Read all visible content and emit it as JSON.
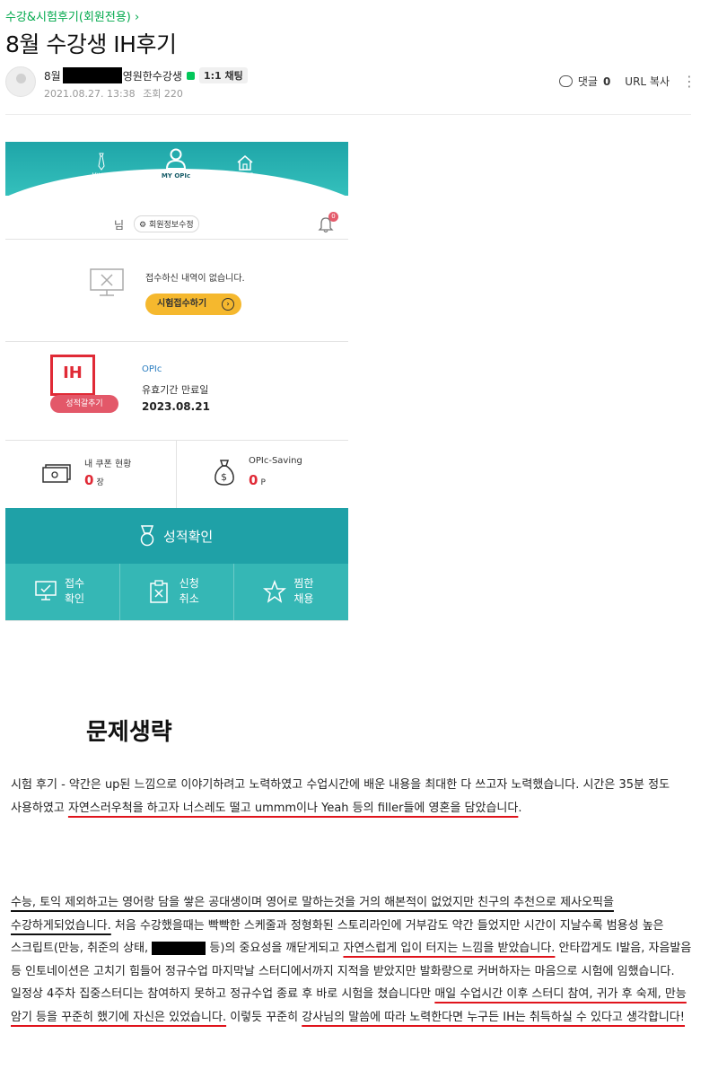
{
  "board": {
    "name": "수강&시험후기(회원전용)",
    "chevron": "›"
  },
  "post": {
    "title": "8월 수강생 IH후기",
    "author_prefix": "8월",
    "author_suffix": "영원한수강생",
    "chat_label": "1:1 채팅",
    "date": "2021.08.27. 13:38",
    "views_label": "조회 220",
    "comment_label": "댓글",
    "comment_count": "0",
    "url_copy_label": "URL 복사"
  },
  "app": {
    "nav": {
      "myjob": "MY JOB",
      "myopic": "MY OPIc",
      "home": "HOME"
    },
    "user_suffix": "님",
    "info_edit": "회원정보수정",
    "bell_badge": "0",
    "no_record": "접수하신 내역이 없습니다.",
    "apply_button": "시험접수하기",
    "grade": "IH",
    "score_button": "성적갈추기",
    "exam_name": "OPIc",
    "expire_label": "유효기간 만료일",
    "expire_date": "2023.08.21",
    "coupon_label": "내 쿠폰 현황",
    "coupon_value": "0",
    "coupon_unit": "장",
    "saving_label": "OPIc-Saving",
    "saving_value": "0",
    "saving_unit": "P",
    "result_button": "성적확인",
    "tabs": [
      {
        "line1": "접수",
        "line2": "확인"
      },
      {
        "line1": "신청",
        "line2": "취소"
      },
      {
        "line1": "찜한",
        "line2": "채용"
      }
    ],
    "colors": {
      "teal": "#1fa1a7",
      "red": "#e02a36",
      "yellow": "#f5b82e",
      "pink": "#e35869"
    }
  },
  "content": {
    "heading": "문제생략",
    "p1_a": "시험 후기 - 약간은 up된 느낌으로 이야기하려고 노력하였고 수업시간에 배운 내용을 최대한 다 쓰고자 노력했습니다. 시간은 35분 정도 사용하였고 ",
    "p1_u": "자연스러우척을 하고자 너스레도 떨고 ummm이나 Yeah 등의 filler들에 영혼을 담았습니다",
    "p1_end": ".",
    "p2_u1": "수능, 토익 제외하고는 영어랑 담을 쌓은 공대생이며 영어로 말하는것을 거의 해본적이 없었지만 친구의 추천으로 제사오픽을 수강하게되었습니다.",
    "p2_a": " 처음 수강했을때는 빡빡한 스케줄과 정형화된 스토리라인에 거부감도 약간 들었지만 시간이 지날수록 범용성 높은 스크립트(만능, 취준의 상태, ",
    "p2_b": " 등)의 중요성을 깨닫게되고 ",
    "p2_u2": "자연스럽게 입이 터지는 느낌을 받았습니다.",
    "p2_c": " 안타깝게도 I발음, 자음발음 등 인토네이션은 고치기 힘들어 정규수업 마지막날 스터디에서까지 지적을 받았지만 발화량으로 커버하자는 마음으로 시험에 임했습니다. 일정상 4주차 집중스터디는 참여하지 못하고 정규수업 종료 후 바로 시험을 쳤습니다만 ",
    "p2_u3": "매일 수업시간 이후 스터디 참여, 귀가 후 숙제, 만능 암기 등을 꾸준히 했기에 자신은 있었습니다.",
    "p2_d": " 이렇듯 꾸준히 ",
    "p2_u4": "강사님의 말씀에 따라 노력한다면 누구든 IH는 취득하실 수 있다고 생각합니다!"
  }
}
